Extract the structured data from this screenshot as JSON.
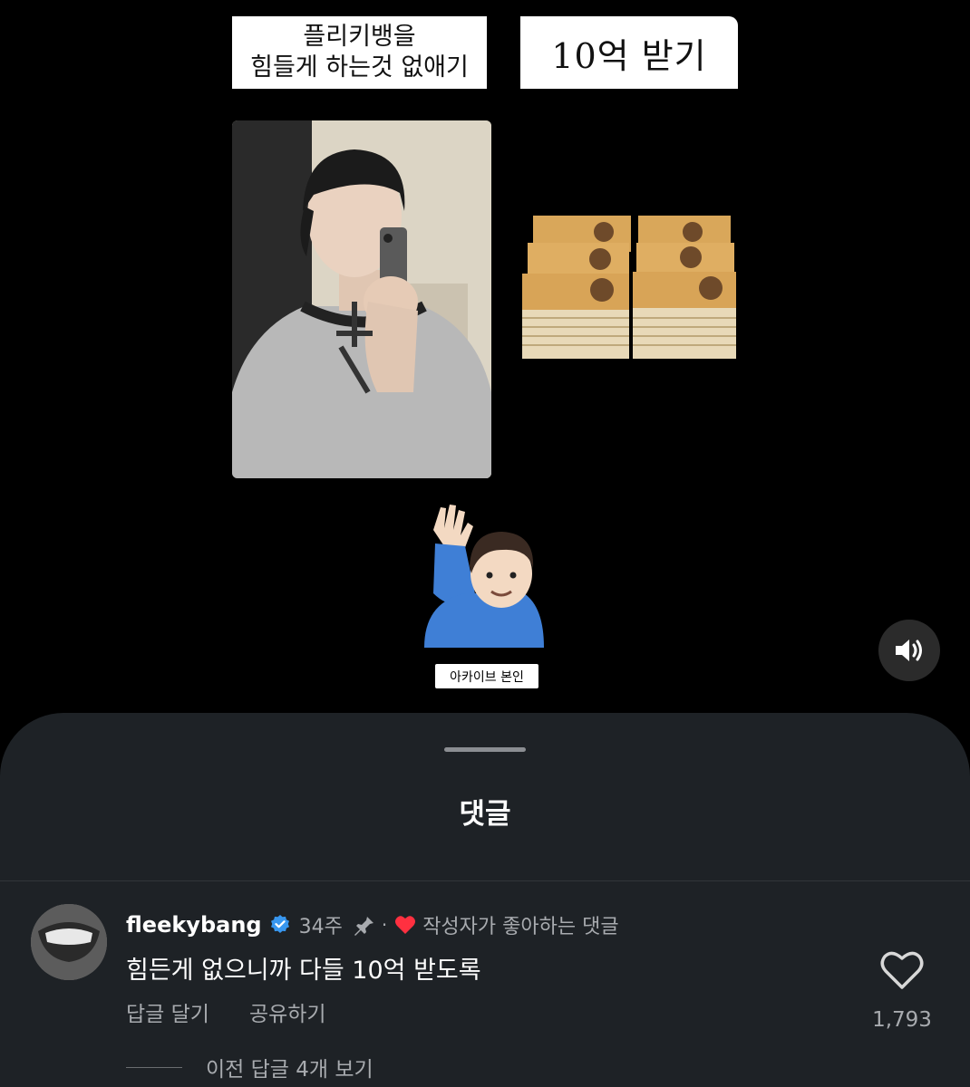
{
  "story": {
    "caption_left_lines": [
      "플리키뱅을",
      "힘들게 하는것 없애기"
    ],
    "caption_right": "10억 받기",
    "sticker_label": "아카이브 본인",
    "images": {
      "selfie": "mirror-selfie-photo",
      "money": "stacked-50000-won-bills",
      "raise": "man-raising-hand-emoji"
    }
  },
  "sheet": {
    "title": "댓글",
    "comment": {
      "username": "fleekybang",
      "time": "34주",
      "separator": "·",
      "liked_label": "작성자가 좋아하는 댓글",
      "text": "힘든게 없으니까 다들 10억 받도록",
      "reply_label": "답글 달기",
      "share_label": "공유하기",
      "like_count": "1,793",
      "view_replies": "이전 답글 4개 보기"
    }
  },
  "colors": {
    "sheet_bg": "#1e2226",
    "verified": "#3897f0",
    "heart": "#ff3040",
    "muted_text": "#a8abaf"
  },
  "icons": [
    "speaker-icon",
    "verified-badge-icon",
    "pin-icon",
    "heart-icon",
    "heart-outline-icon"
  ]
}
